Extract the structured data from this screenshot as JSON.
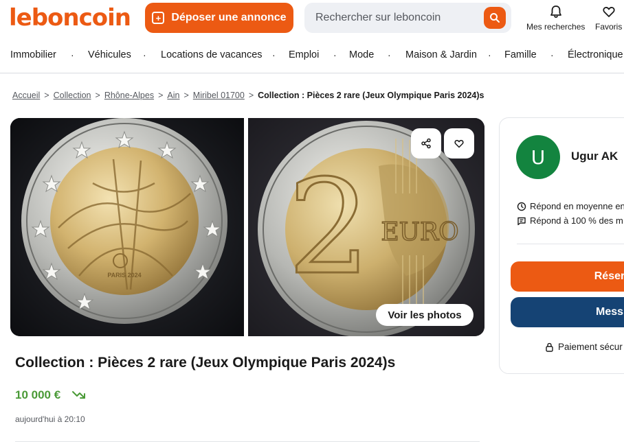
{
  "header": {
    "logo": "leboncoin",
    "post_button": "Déposer une annonce",
    "search_placeholder": "Rechercher sur leboncoin",
    "searches_label": "Mes recherches",
    "favorites_label": "Favoris"
  },
  "nav": {
    "items": [
      "Immobilier",
      "Véhicules",
      "Locations de vacances",
      "Emploi",
      "Mode",
      "Maison & Jardin",
      "Famille",
      "Électronique"
    ],
    "separator": "·"
  },
  "breadcrumb": {
    "items": [
      "Accueil",
      "Collection",
      "Rhône-Alpes",
      "Ain",
      "Miribel 01700"
    ],
    "separator": ">",
    "current": "Collection : Pièces 2 rare (Jeux Olympique Paris 2024)s"
  },
  "gallery": {
    "voir_photos": "Voir les photos",
    "left_coin_text": "PARIS 2024",
    "right_coin_value": "2",
    "right_coin_text": "EURO"
  },
  "listing": {
    "title": "Collection : Pièces 2 rare (Jeux Olympique Paris 2024)s",
    "price": "10 000 €",
    "date": "aujourd'hui à 20:10"
  },
  "seller": {
    "initial": "U",
    "name": "Ugur AK",
    "response_time": "Répond en moyenne en",
    "response_rate": "Répond à 100 % des m",
    "reserve_button": "Réser",
    "message_button": "Mess",
    "secure_payment": "Paiement sécur"
  },
  "colors": {
    "brand": "#ec5a13",
    "price": "#4a9a37",
    "message_button": "#154374",
    "avatar": "#13843f"
  }
}
